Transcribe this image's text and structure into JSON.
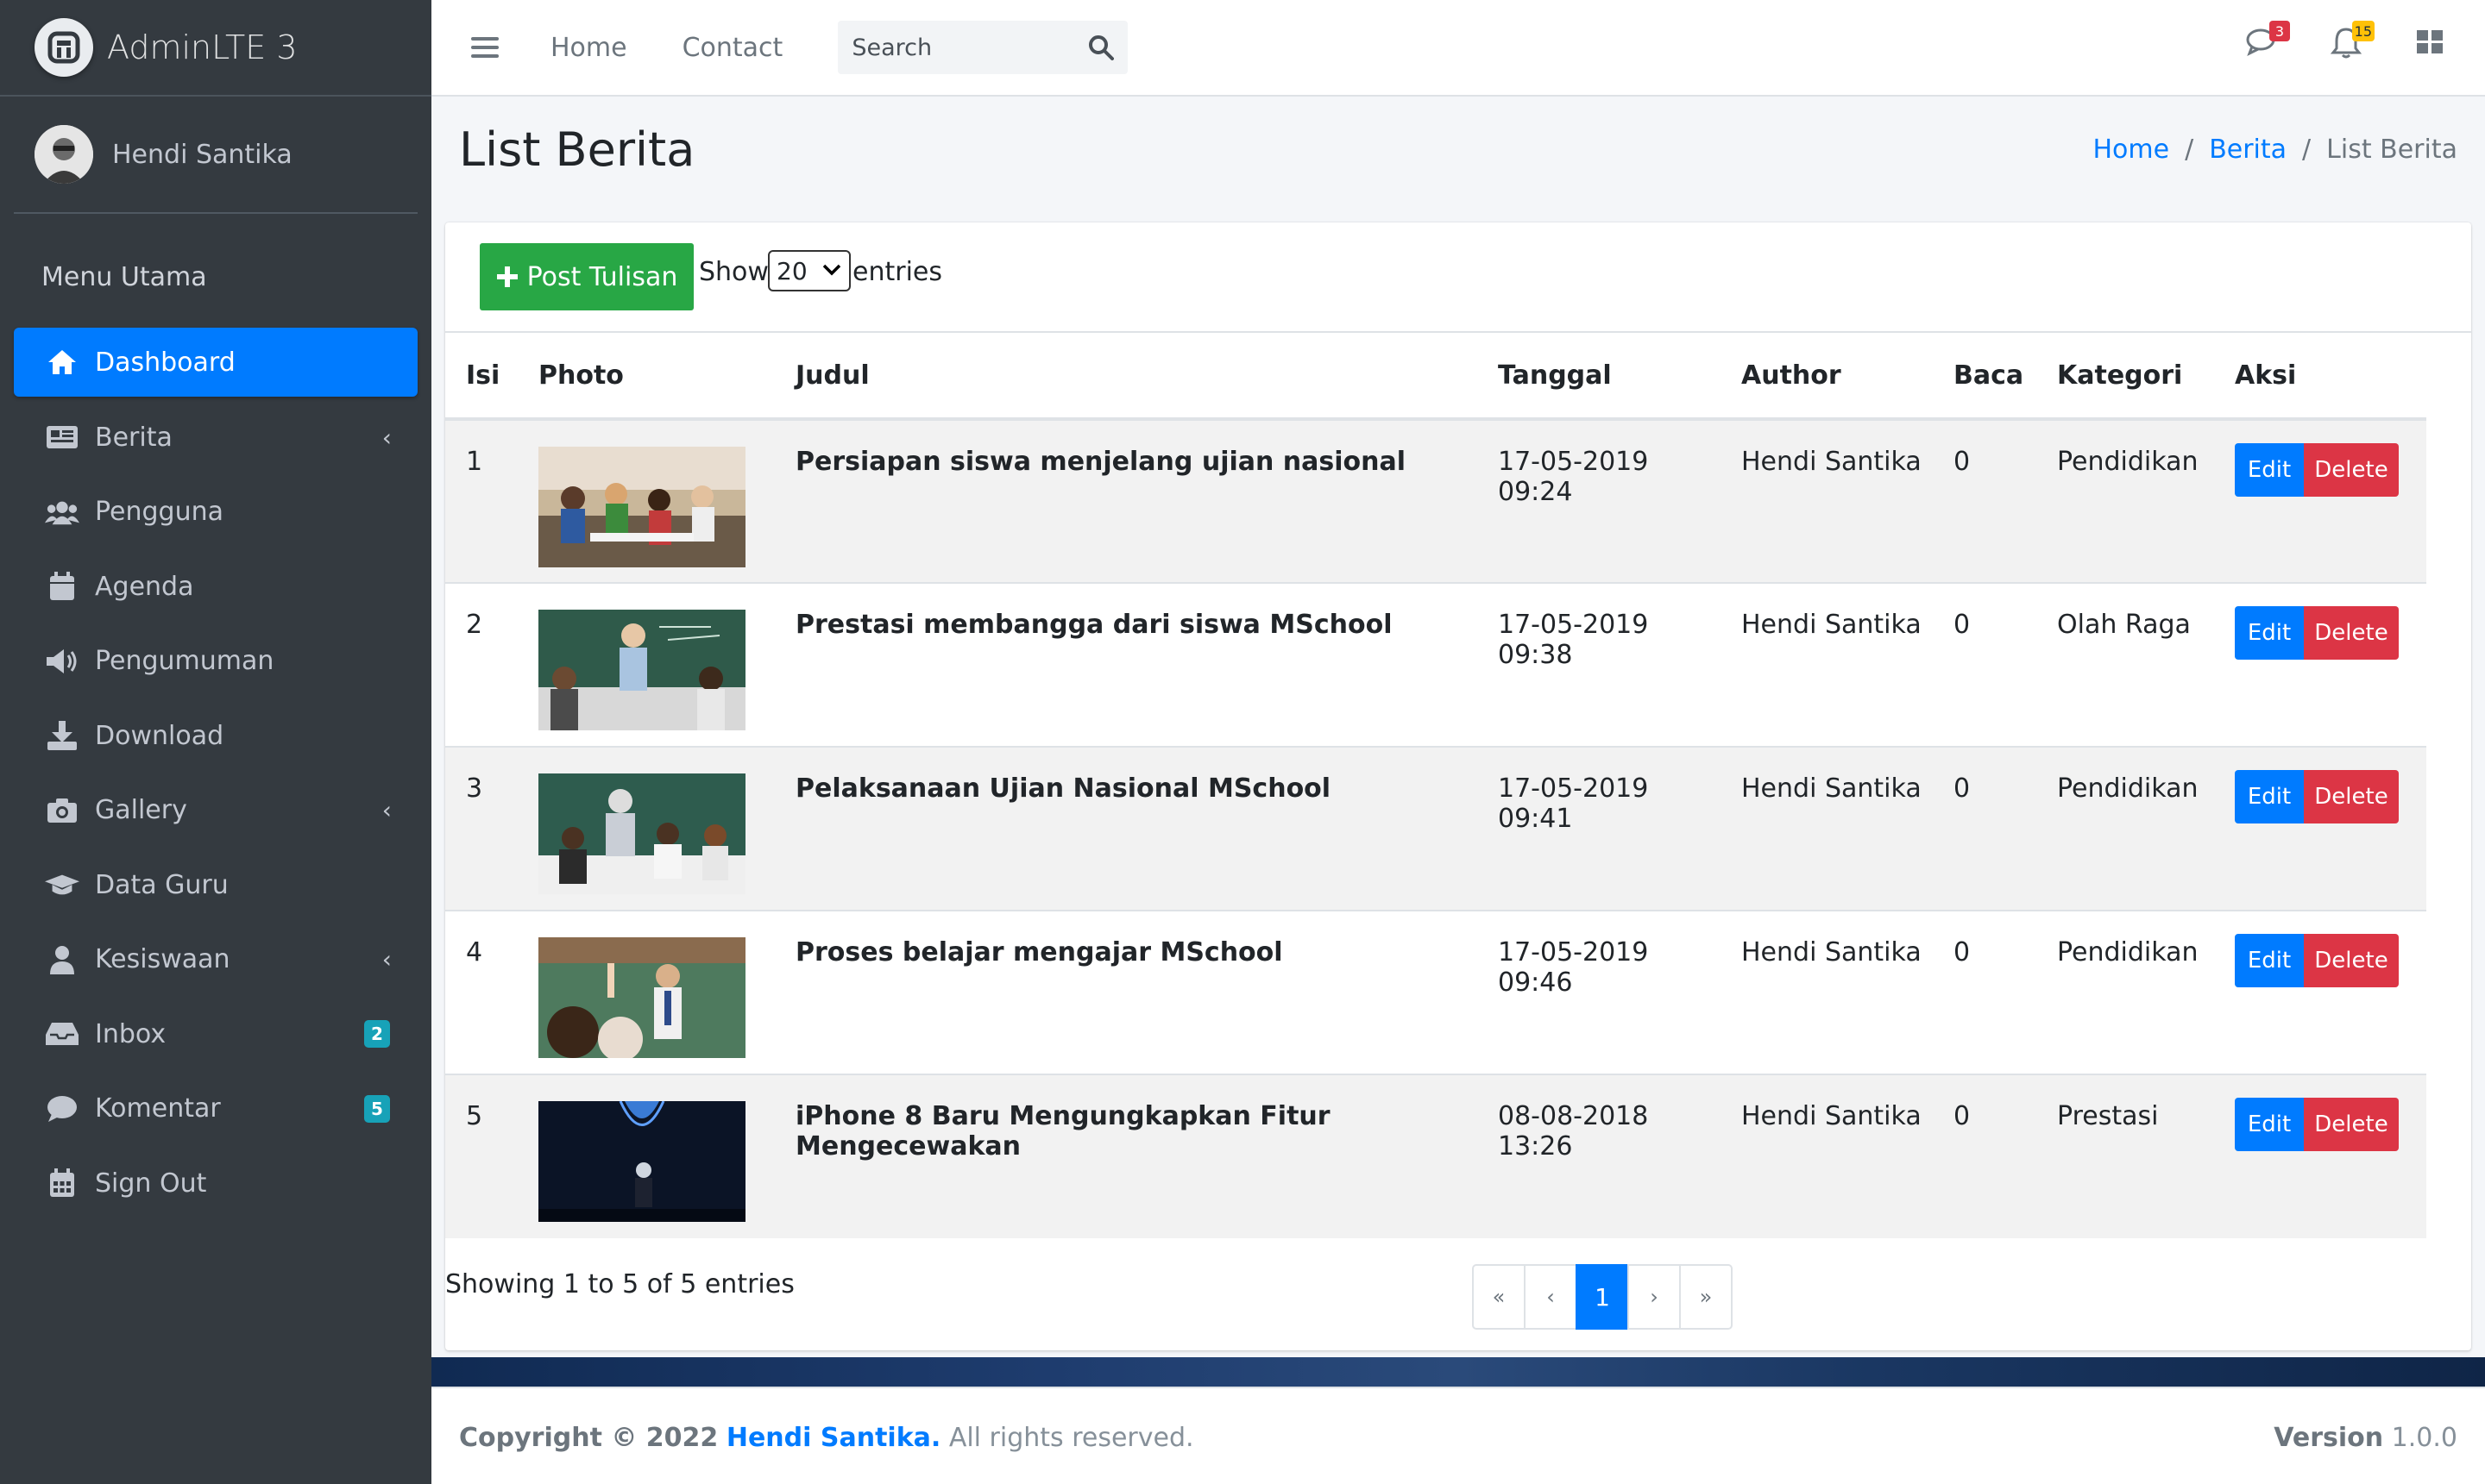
{
  "brand": {
    "name": "AdminLTE 3"
  },
  "user": {
    "name": "Hendi Santika"
  },
  "sidebar": {
    "header": "Menu Utama",
    "items": [
      {
        "label": "Dashboard",
        "icon": "home-icon",
        "active": true
      },
      {
        "label": "Berita",
        "icon": "newspaper-icon",
        "arrow": true
      },
      {
        "label": "Pengguna",
        "icon": "users-icon"
      },
      {
        "label": "Agenda",
        "icon": "calendar-icon"
      },
      {
        "label": "Pengumuman",
        "icon": "megaphone-icon"
      },
      {
        "label": "Download",
        "icon": "download-icon"
      },
      {
        "label": "Gallery",
        "icon": "camera-icon",
        "arrow": true
      },
      {
        "label": "Data Guru",
        "icon": "graduation-cap-icon"
      },
      {
        "label": "Kesiswaan",
        "icon": "user-icon",
        "arrow": true
      },
      {
        "label": "Inbox",
        "icon": "inbox-icon",
        "badge": "2"
      },
      {
        "label": "Komentar",
        "icon": "comment-icon",
        "badge": "5"
      },
      {
        "label": "Sign Out",
        "icon": "calendar-grid-icon"
      }
    ]
  },
  "topbar": {
    "links": [
      "Home",
      "Contact"
    ],
    "search_placeholder": "Search",
    "messages_badge": "3",
    "notifications_badge": "15"
  },
  "page": {
    "title": "List Berita",
    "breadcrumb": [
      "Home",
      "Berita",
      "List Berita"
    ]
  },
  "toolbar": {
    "post_label": "Post Tulisan",
    "show_label": "Show",
    "entries_value": "20",
    "entries_label": "entries"
  },
  "table": {
    "headers": [
      "Isi",
      "Photo",
      "Judul",
      "Tanggal",
      "Author",
      "Baca",
      "Kategori",
      "Aksi"
    ],
    "rows": [
      {
        "no": "1",
        "judul": "Persiapan siswa menjelang ujian nasional",
        "tanggal": "17-05-2019 09:24",
        "author": "Hendi Santika",
        "baca": "0",
        "kategori": "Pendidikan"
      },
      {
        "no": "2",
        "judul": "Prestasi membangga dari siswa MSchool",
        "tanggal": "17-05-2019 09:38",
        "author": "Hendi Santika",
        "baca": "0",
        "kategori": "Olah Raga"
      },
      {
        "no": "3",
        "judul": "Pelaksanaan Ujian Nasional MSchool",
        "tanggal": "17-05-2019 09:41",
        "author": "Hendi Santika",
        "baca": "0",
        "kategori": "Pendidikan"
      },
      {
        "no": "4",
        "judul": "Proses belajar mengajar MSchool",
        "tanggal": "17-05-2019 09:46",
        "author": "Hendi Santika",
        "baca": "0",
        "kategori": "Pendidikan"
      },
      {
        "no": "5",
        "judul": "iPhone 8 Baru Mengungkapkan Fitur Mengecewakan",
        "tanggal": "08-08-2018 13:26",
        "author": "Hendi Santika",
        "baca": "0",
        "kategori": "Prestasi"
      }
    ],
    "edit_label": "Edit",
    "delete_label": "Delete"
  },
  "pagination": {
    "info": "Showing 1 to 5 of 5 entries",
    "first": "«",
    "prev": "‹",
    "current": "1",
    "next": "›",
    "last": "»"
  },
  "footer": {
    "copyright": "Copyright © 2022",
    "author": "Hendi Santika.",
    "rights": "All rights reserved.",
    "version_label": "Version",
    "version": "1.0.0"
  },
  "colors": {
    "sidebar_bg": "#343a40",
    "primary": "#007bff",
    "success": "#28a745",
    "danger": "#dc3545",
    "info": "#17a2b8",
    "warning": "#ffc107"
  }
}
